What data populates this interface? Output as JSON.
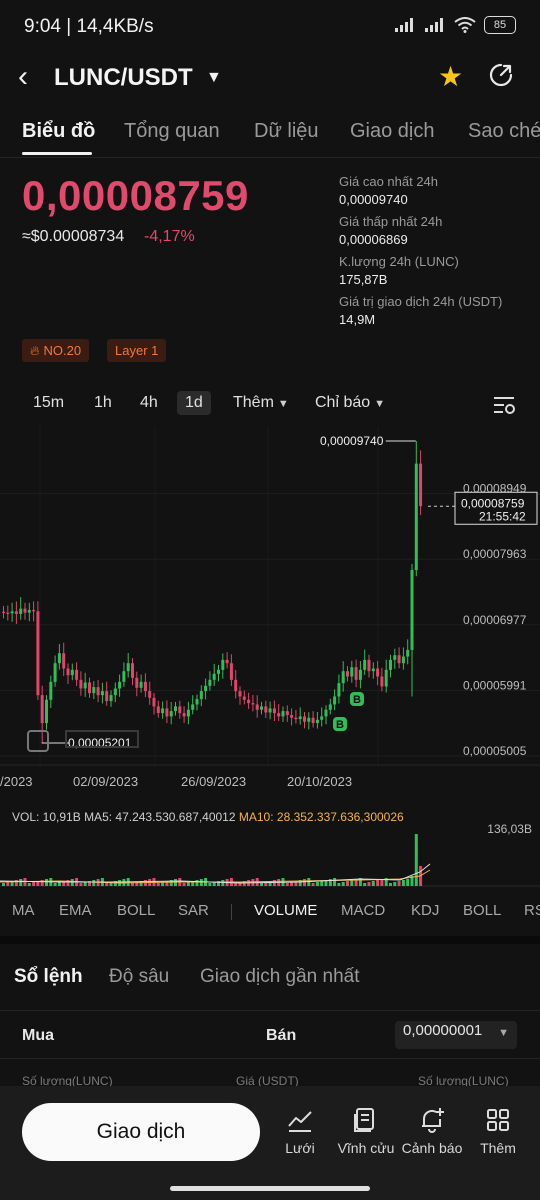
{
  "status_bar": {
    "time": "9:04 | 14,4KB/s",
    "battery": "85"
  },
  "header": {
    "pair": "LUNC/USDT"
  },
  "tabs": [
    "Biểu đồ",
    "Tổng quan",
    "Dữ liệu",
    "Giao dịch",
    "Sao chép"
  ],
  "price": {
    "last": "0,00008759",
    "usd": "≈$0.00008734",
    "change": "-4,17%"
  },
  "stats": [
    {
      "label": "Giá cao nhất 24h",
      "value": "0,00009740"
    },
    {
      "label": "Giá thấp nhất 24h",
      "value": "0,00006869"
    },
    {
      "label": "K.lượng 24h (LUNC)",
      "value": "175,87B"
    },
    {
      "label": "Giá trị giao dịch 24h (USDT)",
      "value": "14,9M"
    }
  ],
  "tags": [
    "NO.20",
    "Layer 1"
  ],
  "intervals": [
    "15m",
    "1h",
    "4h",
    "1d",
    "Thêm",
    "Chỉ báo"
  ],
  "chart_data": {
    "type": "candlestick",
    "interval": "1d",
    "ylim": [
      5.005e-05,
      9.74e-05
    ],
    "y_ticks": [
      "0,00008949",
      "0,00007963",
      "0,00006977",
      "0,00005991",
      "0,00005005"
    ],
    "x_ticks": [
      "/2023",
      "02/09/2023",
      "26/09/2023",
      "20/10/2023"
    ],
    "high_label": "0,00009740",
    "low_label": "0,00005201",
    "current_price_label": "0,00008759",
    "countdown": "21:55:42",
    "markers": [
      "B",
      "B"
    ],
    "colors": {
      "up": "#2fbf5a",
      "down": "#e0456a"
    }
  },
  "volume": {
    "vol": "VOL: 10,91B",
    "ma5": "MA5: 47.243.530.687,40012",
    "ma10": "MA10: 28.352.337.636,300026",
    "max": "136,03B"
  },
  "indicators": [
    "MA",
    "EMA",
    "BOLL",
    "SAR",
    "VOLUME",
    "MACD",
    "KDJ",
    "BOLL",
    "RSI"
  ],
  "order_book": {
    "tabs": [
      "Sổ lệnh",
      "Độ sâu",
      "Giao dịch gần nhất"
    ],
    "buy": "Mua",
    "sell": "Bán",
    "precision": "0,00000001",
    "cols": [
      "Số lượng(LUNC)",
      "Giá (USDT)",
      "Số lượng(LUNC)"
    ]
  },
  "bottom_bar": {
    "trade": "Giao dịch",
    "nav": [
      "Lưới",
      "Vĩnh cửu",
      "Cảnh báo",
      "Thêm"
    ]
  }
}
